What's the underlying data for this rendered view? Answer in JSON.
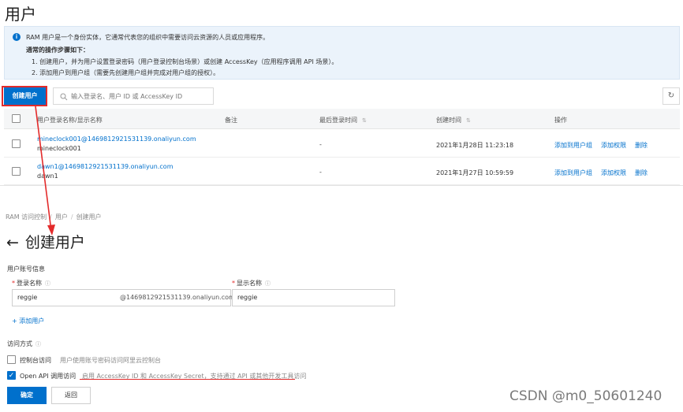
{
  "users_page": {
    "title": "用户",
    "notice": {
      "line1": "RAM 用户是一个身份实体，它通常代表您的组织中需要访问云资源的人员或应用程序。",
      "line2": "通常的操作步骤如下：",
      "line3": "1. 创建用户，并为用户设置登录密码（用户登录控制台场景）或创建 AccessKey（应用程序调用 API 场景）。",
      "line4": "2. 添加用户到用户组（需要先创建用户组并完成对用户组的授权）。"
    },
    "create_button": "创建用户",
    "search_placeholder": "输入登录名、用户 ID 或 AccessKey ID",
    "table": {
      "columns": [
        "用户登录名称/显示名称",
        "备注",
        "最后登录时间",
        "创建时间",
        "操作"
      ],
      "rows": [
        {
          "login": "mineclock001@1469812921531139.onaliyun.com",
          "display": "mineclock001",
          "remark": "-",
          "last_login": "-",
          "created": "2021年1月28日 11:23:18",
          "actions": [
            "添加到用户组",
            "添加权限",
            "删除"
          ]
        },
        {
          "login": "dawn1@1469812921531139.onaliyun.com",
          "display": "dawn1",
          "remark": "-",
          "last_login": "-",
          "created": "2021年1月27日 10:59:59",
          "actions": [
            "添加到用户组",
            "添加权限",
            "删除"
          ]
        }
      ]
    }
  },
  "create_page": {
    "breadcrumb": [
      "RAM 访问控制",
      "用户",
      "创建用户"
    ],
    "title": "创建用户",
    "account_section": "用户账号信息",
    "login_name_label": "登录名称",
    "display_name_label": "显示名称",
    "login_name_value": "reggie",
    "domain_suffix": "@1469812921531139.onaliyun.com",
    "display_name_value": "reggie",
    "add_user_link": "+ 添加用户",
    "access_section": "访问方式",
    "console_access": {
      "label": "控制台访问",
      "desc": "用户使用账号密码访问阿里云控制台",
      "checked": false
    },
    "api_access": {
      "label": "Open API 调用访问",
      "desc": "启用 AccessKey ID 和 AccessKey Secret，支持通过 API 或其他开发工具访问",
      "checked": true
    },
    "ok_button": "确定",
    "back_button": "返回"
  },
  "watermark": "CSDN @m0_50601240",
  "colors": {
    "primary": "#0070cc",
    "annotation_red": "#e32b2b",
    "notice_bg": "#ebf3fb"
  }
}
